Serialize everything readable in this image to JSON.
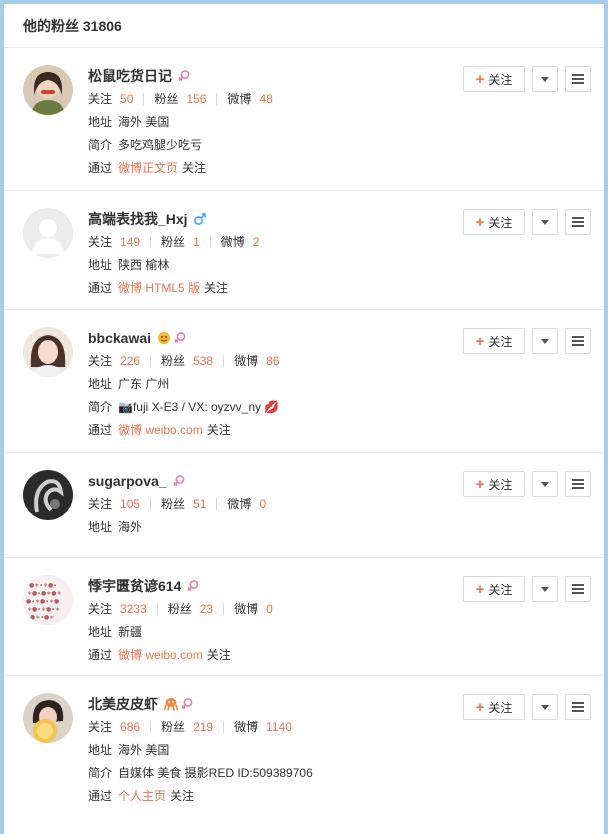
{
  "header": {
    "title": "他的粉丝 31806"
  },
  "labels": {
    "follow_btn": "关注",
    "follow_stat": "关注",
    "fans_stat": "粉丝",
    "weibo_stat": "微博",
    "location_key": "地址",
    "intro_key": "简介",
    "via_key": "通过",
    "via_suffix": "关注"
  },
  "colors": {
    "accent": "#eb7350",
    "female": "#e87eb2",
    "male": "#3fa9f5"
  },
  "users": [
    {
      "name": "松鼠吃货日记",
      "gender": "female",
      "follow": "50",
      "fans": "156",
      "weibo": "48",
      "location": "海外 美国",
      "intro": "多吃鸡腿少吃亏",
      "via": "微博正文页"
    },
    {
      "name": "高端表找我_Hxj",
      "gender": "male",
      "follow": "149",
      "fans": "1",
      "weibo": "2",
      "location": "陕西 榆林",
      "intro": "",
      "via": "微博 HTML5 版"
    },
    {
      "name": "bbckawai",
      "gender": "female",
      "follow": "226",
      "fans": "538",
      "weibo": "86",
      "location": "广东 广州",
      "intro": "📷fuji X-E3 / VX: oyzvv_ny 💋",
      "via": "微博 weibo.com"
    },
    {
      "name": "sugarpova_",
      "gender": "female",
      "follow": "105",
      "fans": "51",
      "weibo": "0",
      "location": "海外",
      "intro": "",
      "via": ""
    },
    {
      "name": "悸宇匮贫谚614",
      "gender": "female",
      "follow": "3233",
      "fans": "23",
      "weibo": "0",
      "location": "新疆",
      "intro": "",
      "via": "微博 weibo.com"
    },
    {
      "name": "北美皮皮虾",
      "gender": "female",
      "follow": "686",
      "fans": "219",
      "weibo": "1140",
      "location": "海外 美国",
      "intro": "自媒体 美食 摄影RED ID:509389706",
      "via": "个人主页"
    }
  ]
}
